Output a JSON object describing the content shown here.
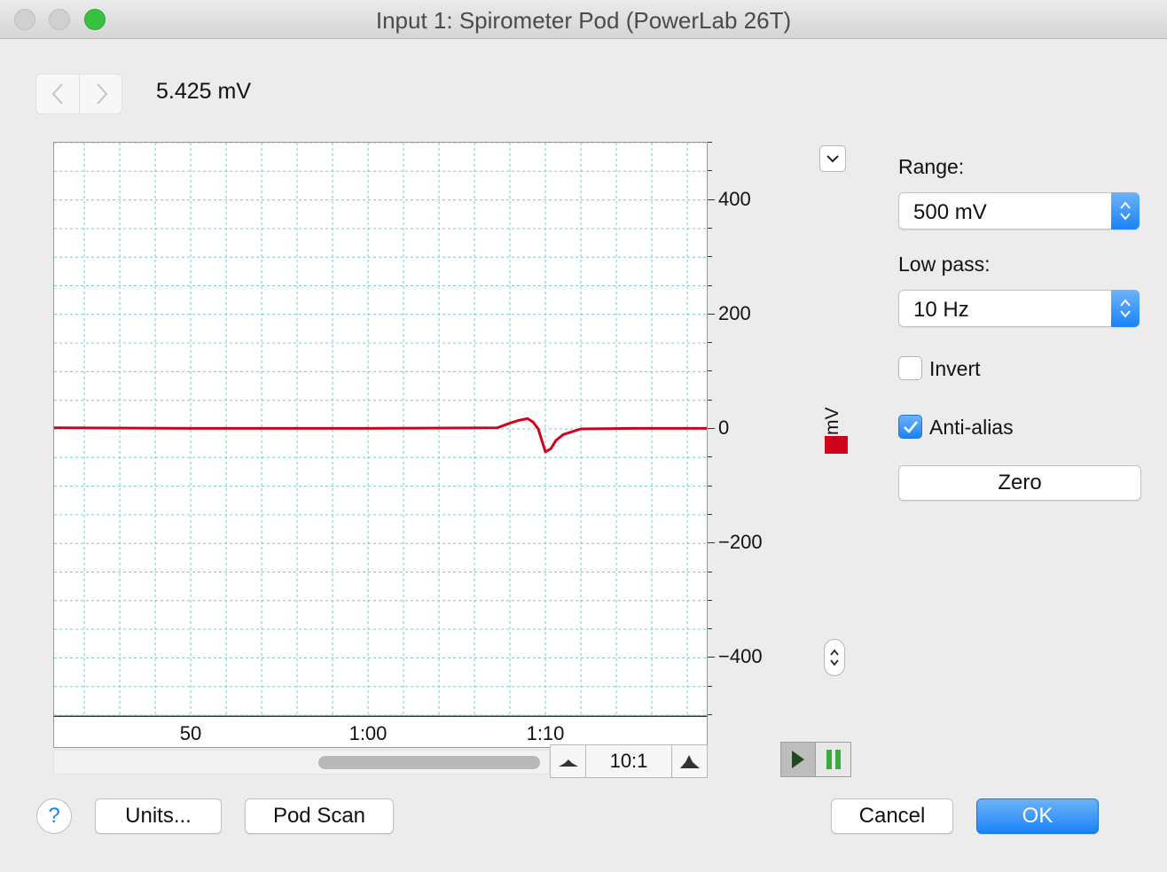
{
  "window": {
    "title": "Input 1: Spirometer Pod (PowerLab 26T)"
  },
  "reading": {
    "value": "5.425 mV"
  },
  "channel": {
    "unit": "mV",
    "color": "#d0021b"
  },
  "zoom": {
    "ratio": "10:1"
  },
  "settings": {
    "range_label": "Range:",
    "range_value": "500 mV",
    "lowpass_label": "Low pass:",
    "lowpass_value": "10 Hz",
    "invert_label": "Invert",
    "invert_checked": false,
    "antialias_label": "Anti-alias",
    "antialias_checked": true,
    "zero_label": "Zero"
  },
  "footer": {
    "help_label": "?",
    "units_label": "Units...",
    "podscan_label": "Pod Scan",
    "cancel_label": "Cancel",
    "ok_label": "OK"
  },
  "chart_data": {
    "type": "line",
    "title": "",
    "xlabel": "",
    "ylabel": "mV",
    "x_tick_labels": [
      "50",
      "1:00",
      "1:10"
    ],
    "x_ticks_seconds": [
      50,
      60,
      70
    ],
    "xlim": [
      42.3,
      79.1
    ],
    "y_tick_labels": [
      "400",
      "200",
      "0",
      "−200",
      "−400"
    ],
    "y_ticks": [
      400,
      200,
      0,
      -200,
      -400
    ],
    "ylim": [
      -500,
      500
    ],
    "grid": true,
    "series": [
      {
        "x": [
          42.3,
          50,
          60,
          67.3,
          68.0,
          68.5,
          69.0,
          69.3,
          69.6,
          69.8,
          70.0,
          70.3,
          70.6,
          71.0,
          71.5,
          72.0,
          75.0,
          79.1
        ],
        "y": [
          2,
          1,
          1,
          2,
          10,
          15,
          18,
          12,
          0,
          -20,
          -40,
          -35,
          -20,
          -10,
          -5,
          0,
          1,
          1
        ]
      }
    ]
  }
}
